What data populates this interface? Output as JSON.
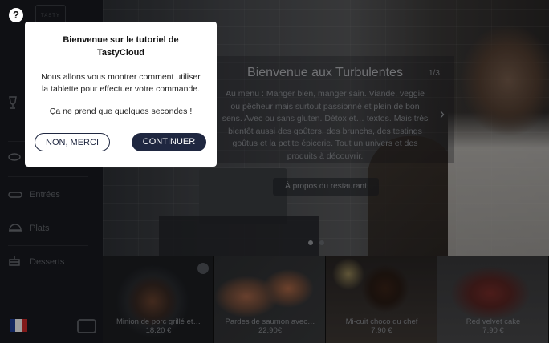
{
  "modal": {
    "title_line1": "Bienvenue sur le tutoriel de",
    "title_line2": "TastyCloud",
    "text_line1": "Nous allons vous montrer comment utiliser",
    "text_line2": "la tablette pour effectuer votre commande.",
    "text_line3": "Ça ne prend que quelques secondes !",
    "decline_label": "NON, MERCI",
    "continue_label": "CONTINUER"
  },
  "header": {
    "help_icon": "?",
    "logo_text": "TASTY CLOUD"
  },
  "sidebar": {
    "items": [
      {
        "icon": "wine-glass-icon",
        "label": ""
      },
      {
        "icon": "loaf-icon",
        "label": ""
      },
      {
        "icon": "dish-icon",
        "label": "Entrées"
      },
      {
        "icon": "cloche-icon",
        "label": "Plats"
      },
      {
        "icon": "cake-icon",
        "label": "Desserts"
      }
    ],
    "language_flag": "fr-flag-icon",
    "flag_colors": [
      "#1f3f99",
      "#ffffff",
      "#d12b2b"
    ]
  },
  "hero": {
    "title": "Bienvenue aux Turbulentes",
    "page_indicator": "1/3",
    "text_line1": "Au menu : Manger bien, manger sain. Viande, veggie",
    "text_line2": "ou pêcheur mais surtout passionné et plein de bon",
    "text_line3": "sens. Avec ou sans gluten. Détox et… textos. Mais très",
    "text_line4": "bientôt aussi des goûters, des brunchs, des testings",
    "text_line5": "goûtus et la petite épicerie. Tout un univers et des",
    "text_line6": "produits à découvrir.",
    "about_button": "À propos du restaurant"
  },
  "products": [
    {
      "name": "Minion de porc grillé et…",
      "price": "18.20 €"
    },
    {
      "name": "Pardes de saumon avec…",
      "price": "22.90€"
    },
    {
      "name": "Mi-cuit choco du chef",
      "price": "7.90 €"
    },
    {
      "name": "Red velvet cake",
      "price": "7.90 €"
    }
  ]
}
